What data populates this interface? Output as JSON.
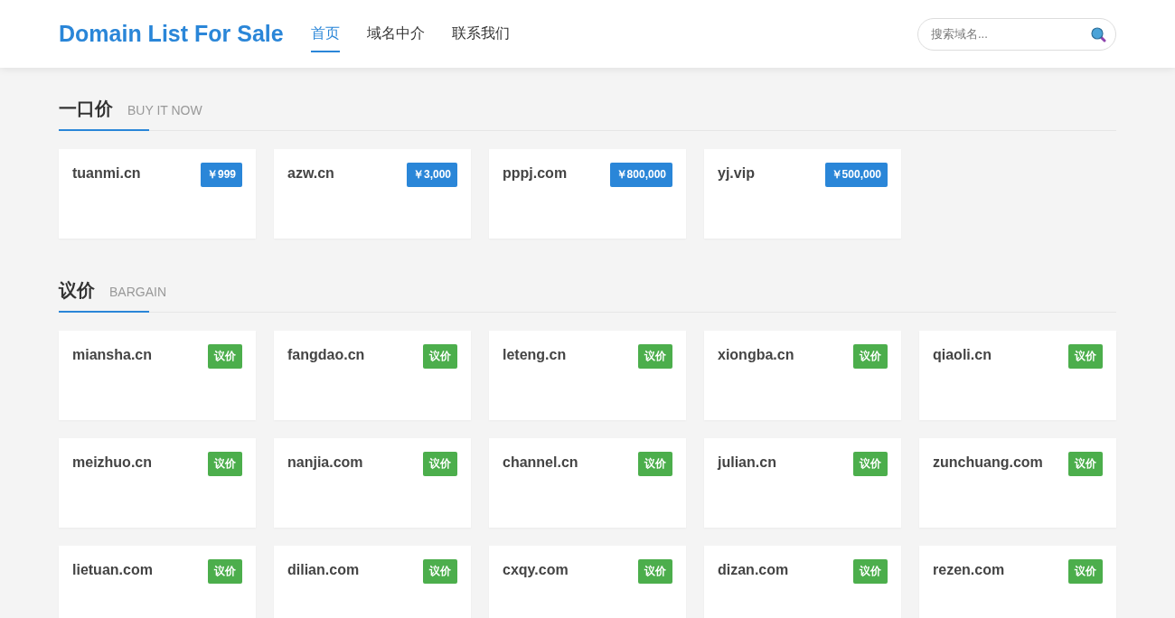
{
  "header": {
    "logo": "Domain List For Sale",
    "nav": [
      {
        "label": "首页",
        "selected": true
      },
      {
        "label": "域名中介",
        "selected": false
      },
      {
        "label": "联系我们",
        "selected": false
      }
    ],
    "search": {
      "placeholder": "搜索域名..."
    }
  },
  "sections": [
    {
      "title": "一口价",
      "subtitle": "BUY IT NOW",
      "kind": "price",
      "cards": [
        {
          "domain": "tuanmi.cn",
          "badge": "￥999"
        },
        {
          "domain": "azw.cn",
          "badge": "￥3,000"
        },
        {
          "domain": "pppj.com",
          "badge": "￥800,000"
        },
        {
          "domain": "yj.vip",
          "badge": "￥500,000"
        }
      ]
    },
    {
      "title": "议价",
      "subtitle": "BARGAIN",
      "kind": "bargain",
      "cards": [
        {
          "domain": "miansha.cn",
          "badge": "议价"
        },
        {
          "domain": "fangdao.cn",
          "badge": "议价"
        },
        {
          "domain": "leteng.cn",
          "badge": "议价"
        },
        {
          "domain": "xiongba.cn",
          "badge": "议价"
        },
        {
          "domain": "qiaoli.cn",
          "badge": "议价"
        },
        {
          "domain": "meizhuo.cn",
          "badge": "议价"
        },
        {
          "domain": "nanjia.com",
          "badge": "议价"
        },
        {
          "domain": "channel.cn",
          "badge": "议价"
        },
        {
          "domain": "julian.cn",
          "badge": "议价"
        },
        {
          "domain": "zunchuang.com",
          "badge": "议价"
        },
        {
          "domain": "lietuan.com",
          "badge": "议价"
        },
        {
          "domain": "dilian.com",
          "badge": "议价"
        },
        {
          "domain": "cxqy.com",
          "badge": "议价"
        },
        {
          "domain": "dizan.com",
          "badge": "议价"
        },
        {
          "domain": "rezen.com",
          "badge": "议价"
        }
      ]
    }
  ]
}
